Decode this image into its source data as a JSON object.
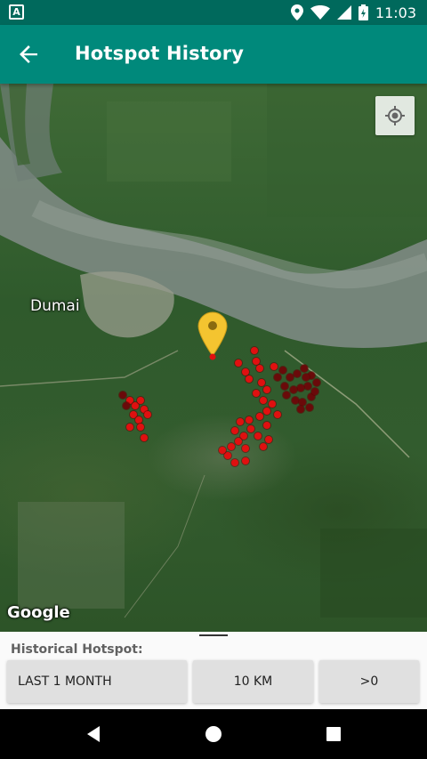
{
  "status_bar": {
    "time": "11:03",
    "notification_icon_letter": "A"
  },
  "app_bar": {
    "title": "Hotspot History",
    "back_icon": "arrow-back-icon"
  },
  "map": {
    "place_label": "Dumai",
    "attribution": "Google",
    "locate_icon": "my-location-icon",
    "marker_color": "#f4c430",
    "hotspot_color": "#e01010"
  },
  "panel": {
    "label": "Historical Hotspot:",
    "time_filter": "LAST 1 MONTH",
    "radius_filter": "10 KM",
    "confidence_filter": ">0"
  },
  "nav_bar": {
    "icons": [
      "back-triangle-icon",
      "home-circle-icon",
      "recents-square-icon"
    ]
  }
}
